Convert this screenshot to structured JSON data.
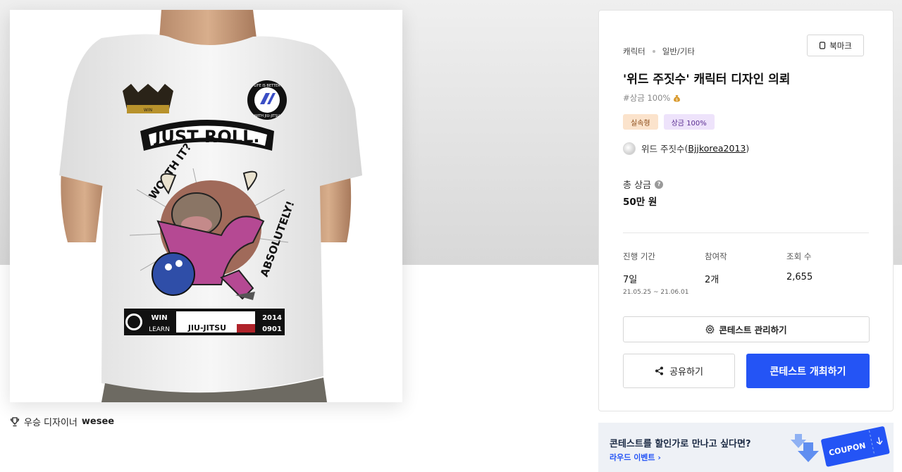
{
  "product": {
    "image_alt": "shirt-back-print",
    "print_texts": {
      "just_roll": "JUST ROLL.",
      "worth_it": "WORTH IT?",
      "absolutely": "ABSOLUTELY!",
      "win": "WIN",
      "learn": "LEARN",
      "brand": "JIU-JITSU",
      "year": "2014",
      "date": "0901",
      "seal_top": "LIFE IS BETTER",
      "seal_bottom": "WITH JIU-JITSU"
    }
  },
  "winner": {
    "icon": "trophy-icon",
    "label": "우승 디자이너",
    "name": "wesee"
  },
  "contest": {
    "category": "캐릭터",
    "subcategory": "일반/기타",
    "bookmark_label": "북마크",
    "title": "'위드 주짓수' 캐릭터 디자인 의뢰",
    "tagline": "#상금 100%",
    "badges": [
      "실속형",
      "상금 100%"
    ],
    "host_name": "위드 주짓수",
    "host_id": "Bjjkorea2013",
    "prize_label": "총 상금",
    "prize_value": "50만 원",
    "stats": {
      "period_label": "진행 기간",
      "period_value": "7일",
      "period_range": "21.05.25 ~ 21.06.01",
      "entries_label": "참여작",
      "entries_value": "2개",
      "views_label": "조회 수",
      "views_value": "2,655"
    },
    "manage_label": "콘테스트 관리하기",
    "share_label": "공유하기",
    "host_contest_label": "콘테스트 개최하기"
  },
  "promo": {
    "question": "콘테스트를 할인가로 만나고 싶다면?",
    "link_label": "라우드 이벤트",
    "coupon_text": "COUPON"
  },
  "colors": {
    "primary": "#2454f5",
    "badge_orange": "#fbe3cc",
    "badge_purple": "#eee3fb"
  }
}
